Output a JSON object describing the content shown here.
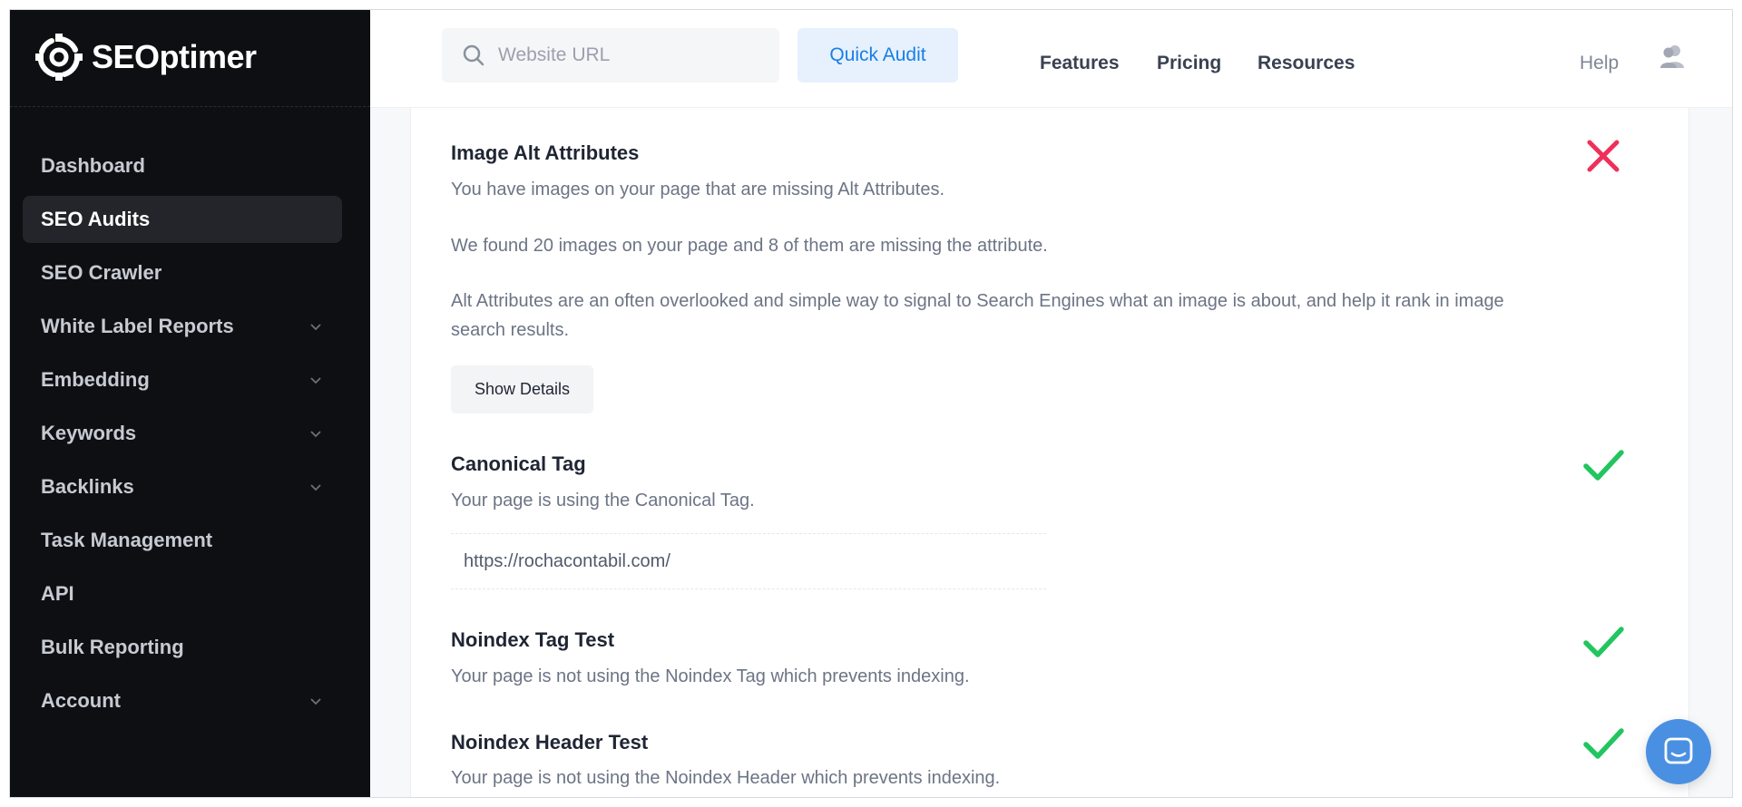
{
  "brand": {
    "name": "SEOptimer"
  },
  "sidebar": {
    "items": [
      {
        "label": "Dashboard",
        "has_chevron": false,
        "active": false
      },
      {
        "label": "SEO Audits",
        "has_chevron": false,
        "active": true
      },
      {
        "label": "SEO Crawler",
        "has_chevron": false,
        "active": false
      },
      {
        "label": "White Label Reports",
        "has_chevron": true,
        "active": false
      },
      {
        "label": "Embedding",
        "has_chevron": true,
        "active": false
      },
      {
        "label": "Keywords",
        "has_chevron": true,
        "active": false
      },
      {
        "label": "Backlinks",
        "has_chevron": true,
        "active": false
      },
      {
        "label": "Task Management",
        "has_chevron": false,
        "active": false
      },
      {
        "label": "API",
        "has_chevron": false,
        "active": false
      },
      {
        "label": "Bulk Reporting",
        "has_chevron": false,
        "active": false
      },
      {
        "label": "Account",
        "has_chevron": true,
        "active": false
      }
    ]
  },
  "header": {
    "search": {
      "placeholder": "Website URL",
      "value": ""
    },
    "quick_audit_label": "Quick Audit",
    "links": [
      "Features",
      "Pricing",
      "Resources"
    ],
    "help_label": "Help"
  },
  "main": {
    "image_alt": {
      "title": "Image Alt Attributes",
      "line1": "You have images on your page that are missing Alt Attributes.",
      "line2": "We found 20 images on your page and 8 of them are missing the attribute.",
      "line3": "Alt Attributes are an often overlooked and simple way to signal to Search Engines what an image is about, and help it rank in image search results.",
      "button_label": "Show Details",
      "status": "fail"
    },
    "canonical": {
      "title": "Canonical Tag",
      "text": "Your page is using the Canonical Tag.",
      "url": "https://rochacontabil.com/",
      "status": "pass"
    },
    "noindex_tag": {
      "title": "Noindex Tag Test",
      "text": "Your page is not using the Noindex Tag which prevents indexing.",
      "status": "pass"
    },
    "noindex_header": {
      "title": "Noindex Header Test",
      "text": "Your page is not using the Noindex Header which prevents indexing.",
      "status": "pass"
    }
  },
  "colors": {
    "sidebar_bg": "#0e0f12",
    "accent_blue": "#1a7ee6",
    "pass_green": "#22c55e",
    "fail_red": "#f0305a",
    "chat_blue": "#4a90e2"
  },
  "icons": {
    "logo": "gear-logo-icon",
    "search": "search-icon",
    "user": "user-group-icon",
    "pass": "checkmark-icon",
    "fail": "x-mark-icon",
    "chat": "chat-bubble-icon",
    "chevron": "chevron-down-icon"
  }
}
